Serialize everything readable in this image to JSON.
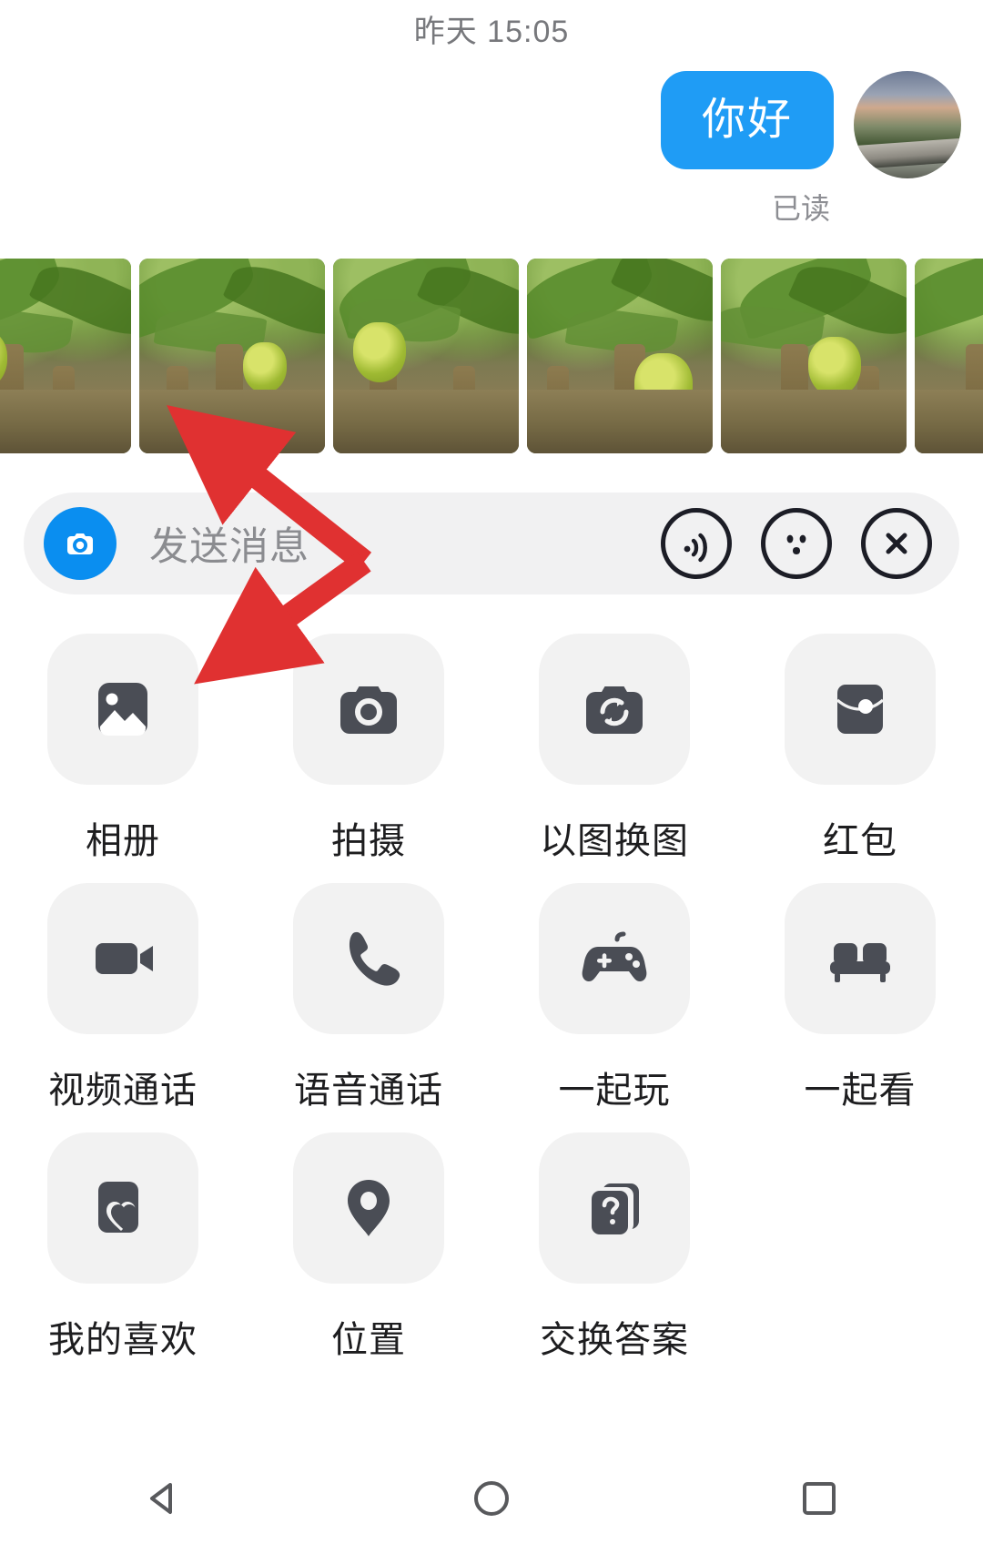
{
  "header": {
    "timestamp": "昨天 15:05"
  },
  "conversation": {
    "outgoing_message": {
      "text": "你好",
      "bubble_color": "#1f9cf5",
      "read_status": "已读"
    },
    "avatar": {
      "name": "user-avatar"
    },
    "photo_strip": {
      "count": 5,
      "items": [
        {
          "alt": "banana-plantation-photo-1"
        },
        {
          "alt": "banana-plantation-photo-2"
        },
        {
          "alt": "banana-plantation-photo-3"
        },
        {
          "alt": "banana-plantation-photo-4"
        },
        {
          "alt": "banana-plantation-photo-5"
        }
      ]
    }
  },
  "input_bar": {
    "camera_icon": "camera-shutter-icon",
    "camera_icon_color": "#0a8ef0",
    "placeholder": "发送消息",
    "value": "",
    "icons": [
      {
        "name": "voice-wave-icon",
        "label": "语音"
      },
      {
        "name": "emoji-face-icon",
        "label": "表情"
      },
      {
        "name": "close-x-icon",
        "label": "关闭"
      }
    ]
  },
  "function_grid": {
    "items": [
      {
        "label": "相册",
        "icon": "photo-gallery-icon"
      },
      {
        "label": "拍摄",
        "icon": "camera-icon"
      },
      {
        "label": "以图换图",
        "icon": "image-swap-icon"
      },
      {
        "label": "红包",
        "icon": "red-packet-icon"
      },
      {
        "label": "视频通话",
        "icon": "video-call-icon"
      },
      {
        "label": "语音通话",
        "icon": "phone-call-icon"
      },
      {
        "label": "一起玩",
        "icon": "gamepad-icon"
      },
      {
        "label": "一起看",
        "icon": "sofa-icon"
      },
      {
        "label": "我的喜欢",
        "icon": "favorite-heart-icon"
      },
      {
        "label": "位置",
        "icon": "location-pin-icon"
      },
      {
        "label": "交换答案",
        "icon": "question-cards-icon"
      }
    ],
    "tile_color": "#f2f2f2",
    "icon_color": "#4a4d55"
  },
  "annotations": {
    "arrow_color": "#e03131",
    "arrows": [
      {
        "name": "arrow-to-photo-strip",
        "points_to": "photo-strip"
      },
      {
        "name": "arrow-to-album-tile",
        "points_to": "相册"
      }
    ]
  },
  "navbar": {
    "buttons": [
      {
        "name": "back-button",
        "icon": "triangle-back-icon"
      },
      {
        "name": "home-button",
        "icon": "circle-home-icon"
      },
      {
        "name": "recents-button",
        "icon": "square-recents-icon"
      }
    ]
  }
}
